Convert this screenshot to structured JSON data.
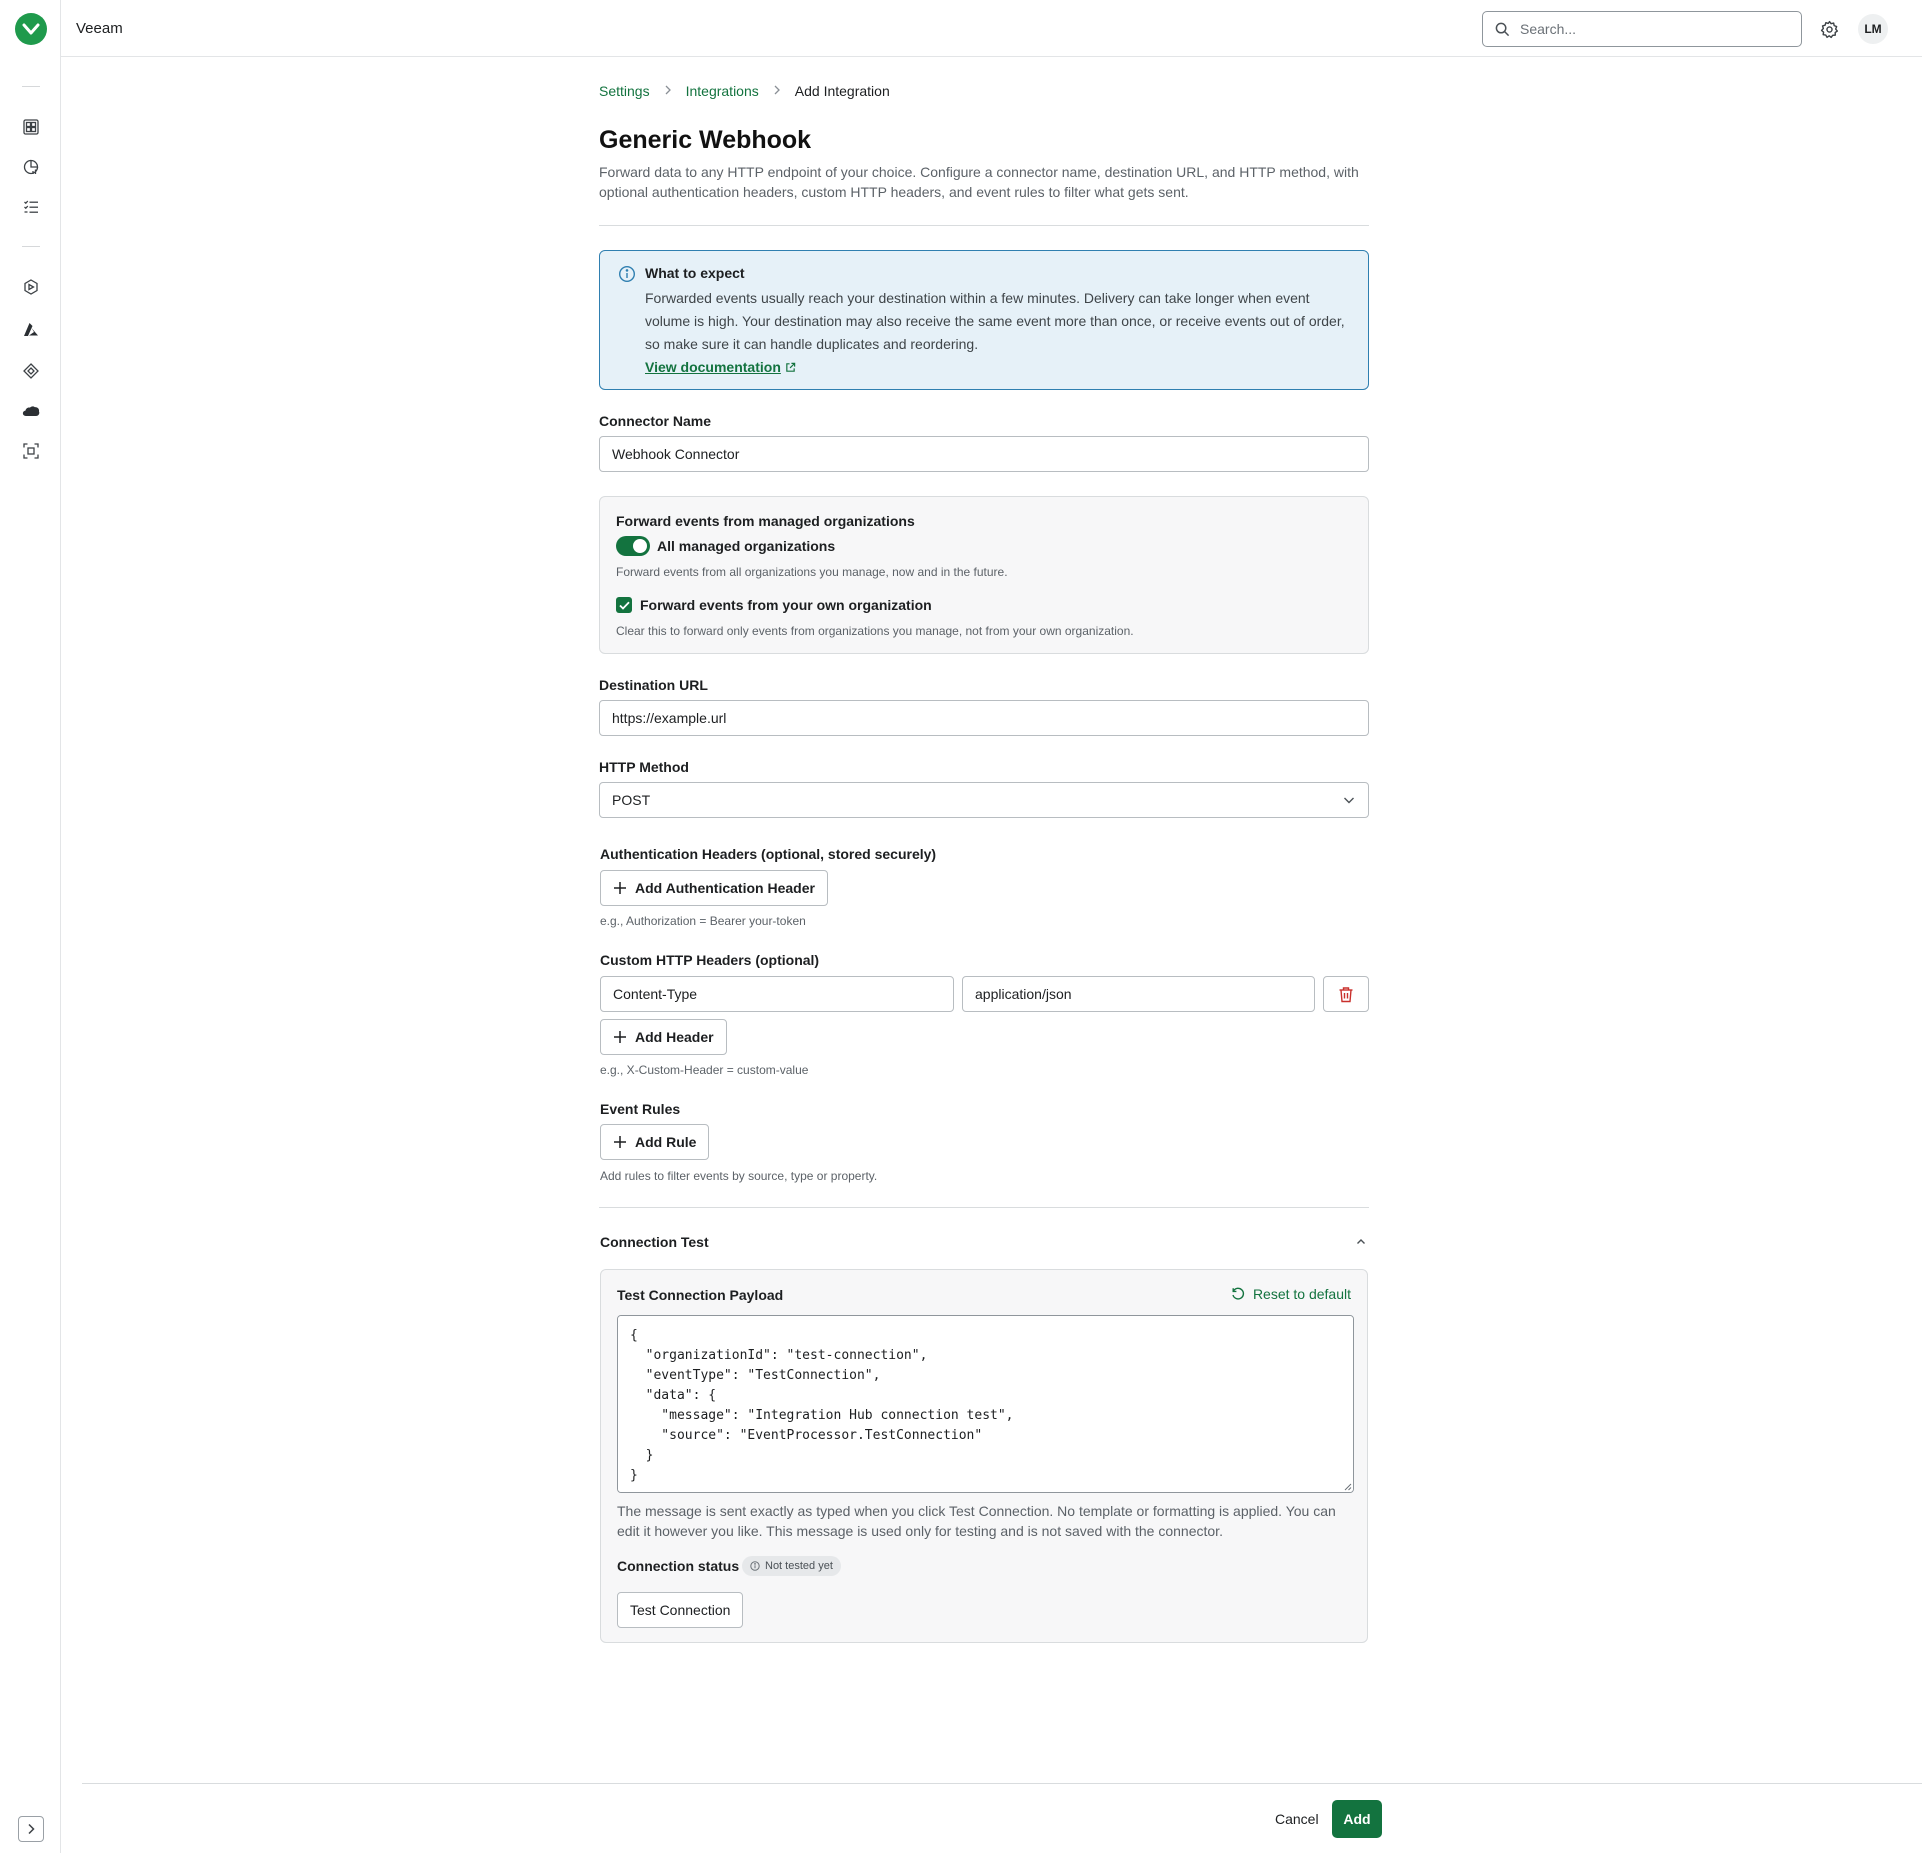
{
  "app": {
    "title": "Veeam",
    "logo_icon": "veeam-logo-icon",
    "brand_color": "#13733f",
    "accent_green": "#1f9a4c"
  },
  "topbar": {
    "search_placeholder": "Search...",
    "settings_icon": "gear-icon",
    "avatar_initials": "LM"
  },
  "sidebar": {
    "items": [
      {
        "icon": "dashboard-icon"
      },
      {
        "icon": "reports-icon"
      },
      {
        "icon": "tasks-list-icon"
      },
      {
        "icon": "integration-hub-icon"
      },
      {
        "icon": "azure-icon"
      },
      {
        "icon": "diamond-icon"
      },
      {
        "icon": "salesforce-cloud-icon"
      },
      {
        "icon": "scan-icon"
      }
    ],
    "expand_icon": "chevron-right-icon"
  },
  "breadcrumb": {
    "items": [
      "Settings",
      "Integrations"
    ],
    "current": "Add Integration"
  },
  "page": {
    "title": "Generic Webhook",
    "description": "Forward data to any HTTP endpoint of your choice. Configure a connector name, destination URL, and HTTP method, with optional authentication headers, custom HTTP headers, and event rules to filter what gets sent."
  },
  "info_box": {
    "title": "What to expect",
    "text": "Forwarded events usually reach your destination within a few minutes. Delivery can take longer when event volume is high. Your destination may also receive the same event more than once, or receive events out of order, so make sure it can handle duplicates and reordering.",
    "link": "View documentation"
  },
  "connector_name": {
    "label": "Connector Name",
    "value": "Webhook Connector"
  },
  "forwarding": {
    "title": "Forward events from managed organizations",
    "toggle_label": "All managed organizations",
    "toggle_on": true,
    "toggle_hint": "Forward events from all organizations you manage, now and in the future.",
    "checkbox_label": "Forward events from your own organization",
    "checkbox_checked": true,
    "checkbox_hint": "Clear this to forward only events from organizations you manage, not from your own organization."
  },
  "destination_url": {
    "label": "Destination URL",
    "value": "https://example.url"
  },
  "http_method": {
    "label": "HTTP Method",
    "value": "POST"
  },
  "auth_headers": {
    "label": "Authentication Headers (optional, stored securely)",
    "button": "Add Authentication Header",
    "hint": "e.g., Authorization = Bearer your-token"
  },
  "custom_headers": {
    "label": "Custom HTTP Headers (optional)",
    "rows": [
      {
        "key": "Content-Type",
        "value": "application/json"
      }
    ],
    "button": "Add Header",
    "hint": "e.g., X-Custom-Header = custom-value"
  },
  "event_rules": {
    "label": "Event Rules",
    "button": "Add Rule",
    "hint": "Add rules to filter events by source, type or property."
  },
  "connection_test": {
    "title": "Connection Test",
    "payload_label": "Test Connection Payload",
    "reset_label": "Reset to default",
    "payload": "{\n  \"organizationId\": \"test-connection\",\n  \"eventType\": \"TestConnection\",\n  \"data\": {\n    \"message\": \"Integration Hub connection test\",\n    \"source\": \"EventProcessor.TestConnection\"\n  }\n}",
    "note": "The message is sent exactly as typed when you click Test Connection. No template or formatting is applied. You can edit it however you like. This message is used only for testing and is not saved with the connector.",
    "status_label": "Connection status",
    "status_value": "Not tested yet",
    "test_button": "Test Connection"
  },
  "footer": {
    "cancel": "Cancel",
    "add": "Add"
  }
}
